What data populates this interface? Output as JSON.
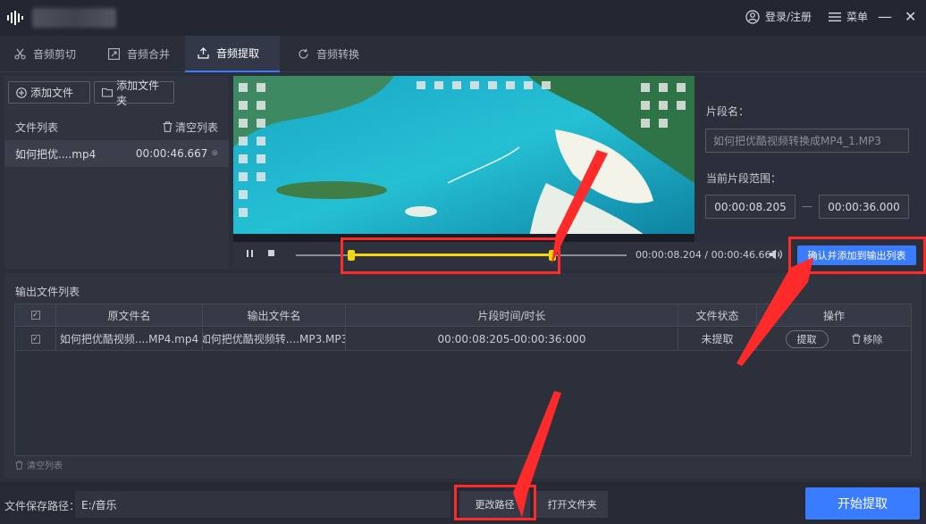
{
  "titlebar": {
    "login_label": "登录/注册",
    "menu_label": "菜单",
    "minimize_glyph": "—",
    "close_glyph": "✕"
  },
  "tabs": [
    {
      "label": "音频剪切",
      "icon": "scissors-icon",
      "active": false
    },
    {
      "label": "音频合并",
      "icon": "merge-icon",
      "active": false
    },
    {
      "label": "音频提取",
      "icon": "upload-icon",
      "active": true
    },
    {
      "label": "音频转换",
      "icon": "refresh-icon",
      "active": false
    }
  ],
  "file_panel": {
    "add_file_label": "添加文件",
    "add_folder_label": "添加文件夹",
    "list_title": "文件列表",
    "clear_list_label": "清空列表",
    "files": [
      {
        "name": "如何把优....mp4",
        "duration": "00:00:46.667"
      }
    ]
  },
  "player": {
    "current_time": "00:00:08.204",
    "separator": " / ",
    "total_time": "00:00:46.667"
  },
  "segment": {
    "name_label": "片段名：",
    "name_placeholder": "如何把优酷视频转换成MP4_1.MP3",
    "range_label": "当前片段范围：",
    "range_start": "00:00:08.205",
    "range_dash": "—",
    "range_end": "00:00:36.000",
    "confirm_label": "确认并添加到输出列表"
  },
  "output": {
    "title": "输出文件列表",
    "columns": [
      "原文件名",
      "输出文件名",
      "片段时间/时长",
      "文件状态",
      "操作"
    ],
    "rows": [
      {
        "source": "如何把优酷视频....MP4.mp4",
        "output": "如何把优酷视频转....MP3.MP3",
        "segment": "00:00:08:205-00:00:36:000",
        "status": "未提取",
        "extract_label": "提取",
        "remove_label": "移除"
      }
    ],
    "clear_label": "清空列表"
  },
  "bottom": {
    "path_label": "文件保存路径：",
    "path_value": "E:/音乐",
    "change_path_label": "更改路径",
    "open_folder_label": "打开文件夹",
    "start_label": "开始提取"
  },
  "colors": {
    "accent": "#3a7cff",
    "highlight": "#ff2a2a",
    "selection": "#f5d60a"
  }
}
